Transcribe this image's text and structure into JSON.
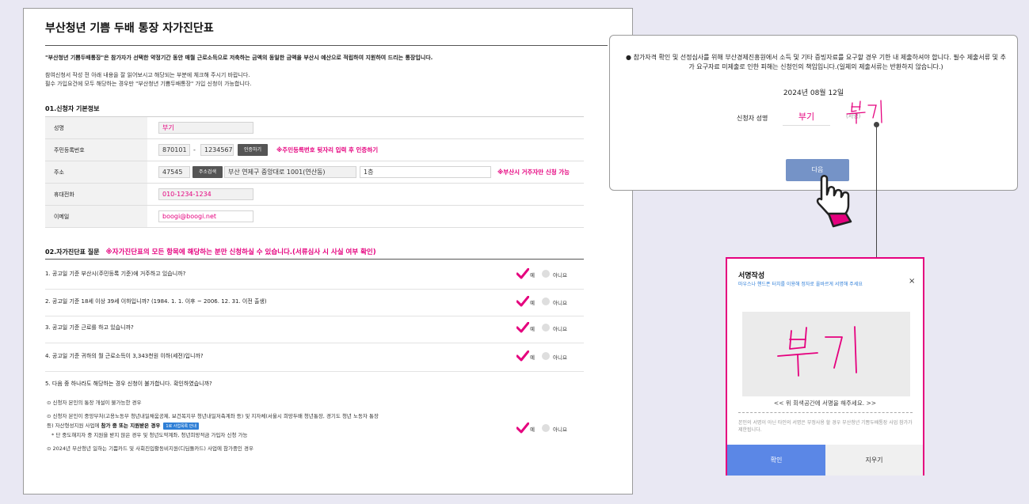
{
  "form": {
    "title": "부산청년 기쁨 두배 통장 자가진단표",
    "intro": "\"부산청년 기쁨두배통장\"은 참가자가 선택한 약정기간 동안 매월 근로소득으로 저축하는 금액의 동일한 금액을 부산시 예산으로 적립하여 지원하여 드리는 통장입니다.",
    "note1": "참여신청서 작성 전 아래 내용을 잘 읽어보시고 해당되는 부분에 체크해 주시기 바랍니다.",
    "note2": "필수 가입요건에 모두 해당하는 경우만 \"부산청년 기쁨두배통장\" 가입 신청이 가능합니다.",
    "section1_title": "01.신청자 기본정보",
    "rows": {
      "name_label": "성명",
      "name_value": "부기",
      "rrn_label": "주민등록번호",
      "rrn_front": "870101",
      "rrn_dash": "-",
      "rrn_back": "1234567",
      "verify_button": "인증하기",
      "rrn_note": "※주민등록번호 뒷자리 입력 후 인증하기",
      "address_label": "주소",
      "zip": "47545",
      "address_search_button": "주소검색",
      "address_main": "부산 연제구 중앙대로 1001(연산동)",
      "address_detail": "1층",
      "address_note": "※부산시 거주자만 신청 가능",
      "phone_label": "휴대전화",
      "phone_value": "010-1234-1234",
      "email_label": "이메일",
      "email_value": "boogi@boogi.net"
    },
    "section2_title": "02.자가진단표 질문",
    "section2_note": "※자가진단표의 모든 항목에 해당하는 분만 신청하실 수 있습니다.(서류심사 시 사실 여부 확인)",
    "yes_label": "예",
    "no_label": "아니요",
    "questions": [
      "1. 공고일 기준 부산시(주민등록 기준)에 거주하고 있습니까?",
      "2. 공고일 기준 18세 이상 39세 이하입니까? (1984. 1. 1. 이후 ~ 2006. 12. 31. 이전 출생)",
      "3. 공고일 기준 근로를 하고 있습니까?",
      "4. 공고일 기준 귀하의 월 근로소득이 3,343천원 이하(세전)입니까?",
      "5. 다음 중 하나라도 해당하는 경우 신청이 불가합니다. 확인하였습니까?"
    ],
    "q5_items": {
      "item1": "⊙ 신청자 본인의 통장 개설이 불가능한 경우",
      "item2_line1": "⊙ 신청자 본인이 중앙부처(고용노동부 청년내일채움공제, 보건복지부 청년내일저축계좌 등) 및 지자체(서울시 희망두배 청년통장, 경기도 청년 노동자 통장",
      "item2_line2_a": "등) 자산형성지원 사업에 ",
      "item2_line2_b": "참가 중 또는 지원받은 경우",
      "item2_tag": "1로 사업목록 안내",
      "item2_line3": "* 단 중도해지자 중 지원을 받지 않은 경우 및 청년도약계좌, 청년희망적금 가입자 신청 가능",
      "item3": "⊙ 2024년 부산청년 일하는 기쁨카드 및 사회진입활동비지원(디딤돌카드) 사업에 참가중인 경우"
    }
  },
  "confirm": {
    "notice": "● 참가자격 확인 및 선정심사를 위해 부산경제진흥원에서 소득 및 기타 증빙자료를 요구할 경우 기한 내 제출하셔야 합니다. 필수 제출서류 및 추가 요구자료 미제출로 인한 피해는 신청인의 책임입니다.(일체의 제출서류는 반환하지 않습니다.)",
    "date": "2024년 08월 12일",
    "name_label": "신청자 성명",
    "name_value": "부기",
    "paren_hint": "(서명)",
    "next_button": "다음"
  },
  "modal": {
    "title": "서명작성",
    "subtitle": "마우스나 핸드폰 터치를 이용해 정자로 올바르게 서명해 주세요",
    "close": "×",
    "pad_hint": "<< 위 회색공간에 서명을 해주세요. >>",
    "warning": "본인의 서명이 아닌 타인의 서명은 부정사용 할 경우 부산청년 기쁨두배통장 사업 참가가 제한됩니다.",
    "ok_button": "확인",
    "clear_button": "지우기"
  },
  "colors": {
    "accent": "#e5007e",
    "button_blue": "#5b87e6",
    "next_button": "#7593c7",
    "background": "#e9e8f3"
  },
  "icons": [
    "check-icon",
    "pointing-hand-icon",
    "close-icon"
  ]
}
